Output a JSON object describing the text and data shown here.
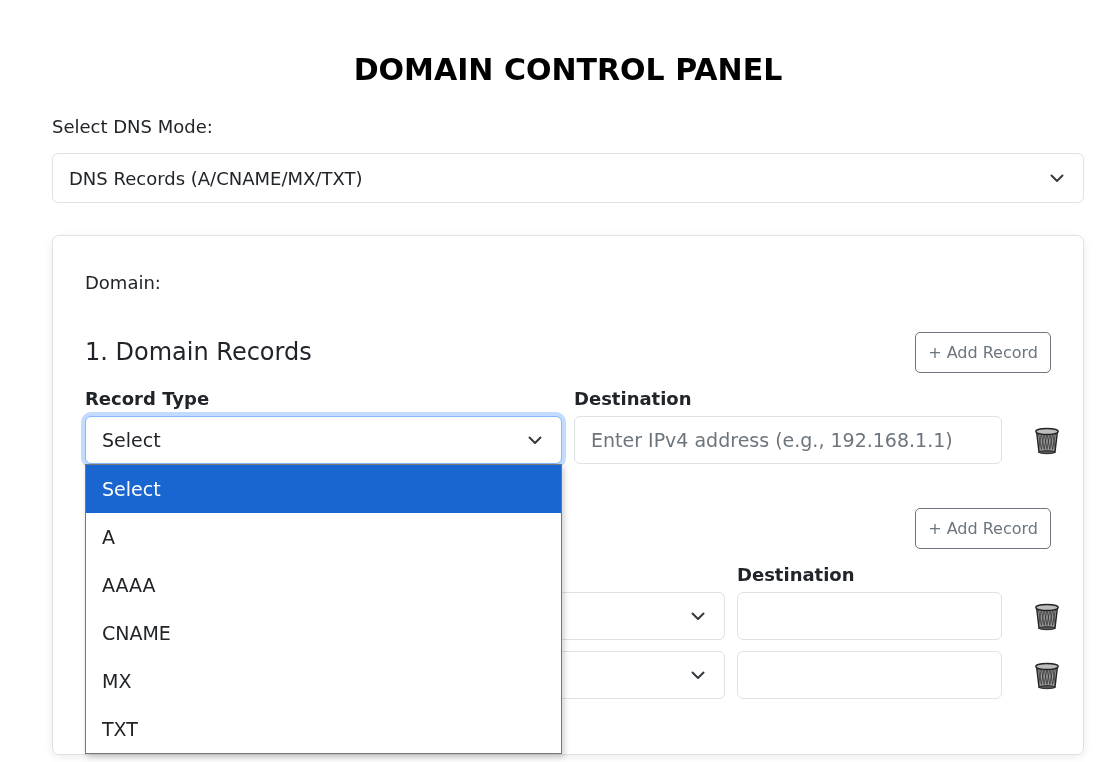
{
  "title": "DOMAIN CONTROL PANEL",
  "mode": {
    "label": "Select DNS Mode:",
    "value": "DNS Records (A/CNAME/MX/TXT)"
  },
  "card": {
    "domain_label": "Domain:",
    "sections": [
      {
        "heading": "1. Domain Records",
        "add_button": "+ Add Record",
        "type_label": "Record Type",
        "destination_label": "Destination",
        "rows": [
          {
            "type": "Select",
            "placeholder": "Enter IPv4 address (e.g., 192.168.1.1)",
            "focused": true,
            "open": true
          }
        ]
      },
      {
        "add_button": "+ Add Record",
        "destination_label": "Destination",
        "rows": [
          {
            "focused": false,
            "open": false
          },
          {
            "focused": false,
            "open": false
          }
        ]
      }
    ]
  },
  "dropdown": {
    "options": [
      {
        "label": "Select",
        "selected": true
      },
      {
        "label": "A",
        "selected": false
      },
      {
        "label": "AAAA",
        "selected": false
      },
      {
        "label": "CNAME",
        "selected": false
      },
      {
        "label": "MX",
        "selected": false
      },
      {
        "label": "TXT",
        "selected": false
      }
    ]
  }
}
